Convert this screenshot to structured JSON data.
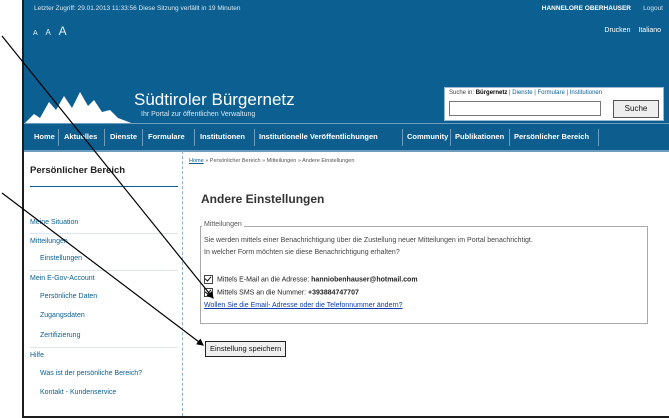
{
  "topbar": {
    "last_access": "Letzter Zugriff: 29.01.2013 11:33:56   Diese Sitzung verfällt in 19 Minuten",
    "user_name": "HANNELORE OBERHAUSER",
    "logout": "Logout"
  },
  "font_size_controls": {
    "small": "A",
    "medium": "A",
    "large": "A"
  },
  "top_links": {
    "print": "Drucken",
    "language": "Italiano"
  },
  "portal": {
    "title": "Südtiroler Bürgernetz",
    "subtitle": "Ihr Portal zur öffentlichen Verwaltung"
  },
  "search": {
    "scope_prefix": "Suche in:",
    "scope_selected": "Bürgernetz",
    "scope_options": "| Dienste | Formulare | Institutionen",
    "button": "Suche",
    "value": ""
  },
  "nav": {
    "items": [
      "Home",
      "Aktuelles",
      "Dienste",
      "Formulare",
      "Institutionen",
      "Institutionelle Veröffentlichungen",
      "Community",
      "Publikationen",
      "Persönlicher Bereich"
    ]
  },
  "sidebar": {
    "title": "Persönlicher Bereich",
    "items": {
      "meine_situation": "Meine Situation",
      "mitteilungen": "Mitteilungen",
      "einstellungen": "Einstellungen",
      "egov_account": "Mein E-Gov-Account",
      "persoenliche_daten": "Persönliche Daten",
      "zugangsdaten": "Zugangsdaten",
      "zertifizierung": "Zertifizierung",
      "hilfe": "Hilfe",
      "was_ist": "Was ist der persönliche Bereich?",
      "kontakt": "Kontakt - Kundenservice"
    }
  },
  "breadcrumb": {
    "home": "Home",
    "rest": "» Persönlicher Bereich » Mitteilungen » Andere Einstellungen"
  },
  "main": {
    "title": "Andere Einstellungen",
    "legend": "Mitteilungen",
    "desc1": "Sie werden mittels einer Benachrichtigung über die Zustellung neuer Mitteilungen im Portal benachrichtigt.",
    "desc2": "In welcher Form möchten sie diese Benachrichtigung erhalten?",
    "email_label": "Mittels E-Mail an die Adresse:",
    "email_value": "hanniobenhauser@hotmail.com",
    "sms_label": "Mittels SMS an die Nummer:",
    "sms_value": "+393884747707",
    "change_link": "Wollen Sie die Email- Adresse oder die Telefonnummer ändern?",
    "save_button": "Einstellung speichern",
    "email_checked": true,
    "sms_checked": true
  },
  "colors": {
    "brand_blue": "#0b6091",
    "nav_blue": "#0d5e8f",
    "link": "#0b3fae"
  }
}
